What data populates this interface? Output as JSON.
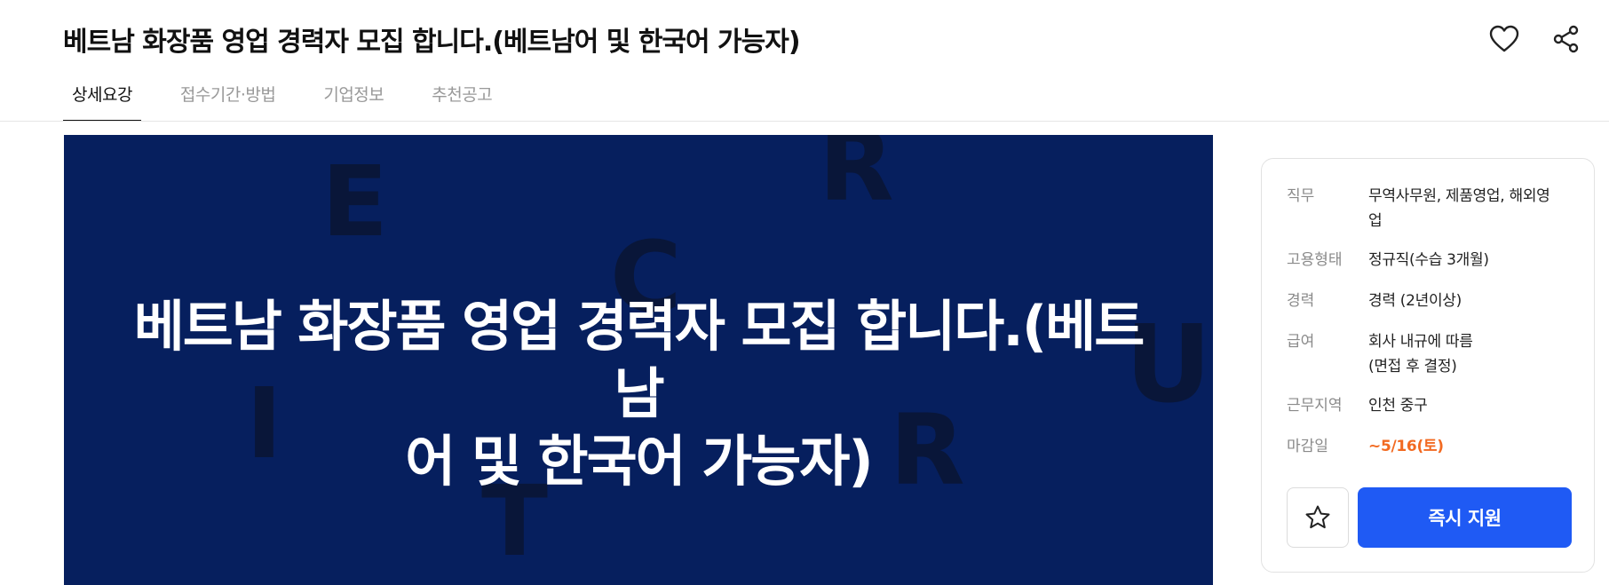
{
  "header": {
    "title": "베트남 화장품 영업 경력자 모집 합니다.(베트남어 및 한국어 가능자)"
  },
  "tabs": [
    {
      "label": "상세요강",
      "active": true
    },
    {
      "label": "접수기간·방법",
      "active": false
    },
    {
      "label": "기업정보",
      "active": false
    },
    {
      "label": "추천공고",
      "active": false
    }
  ],
  "banner": {
    "line1": "베트남 화장품 영업 경력자 모집 합니다.(베트남",
    "line2": "어 및 한국어 가능자)",
    "background_color": "#061f5e",
    "background_letters": [
      "E",
      "R",
      "C",
      "U",
      "I",
      "R",
      "T"
    ]
  },
  "info": {
    "job": {
      "label": "직무",
      "value_line1": "무역사무원, 제품영업, 해외영",
      "value_line2": "업"
    },
    "employment_type": {
      "label": "고용형태",
      "value": "정규직(수습 3개월)"
    },
    "career": {
      "label": "경력",
      "value": "경력 (2년이상)"
    },
    "salary": {
      "label": "급여",
      "value_line1": "회사 내규에 따름",
      "value_line2": "(면접 후 결정)"
    },
    "location": {
      "label": "근무지역",
      "value": "인천 중구"
    },
    "deadline": {
      "label": "마감일",
      "value": "~5/16(토)",
      "color": "#f26a21"
    }
  },
  "actions": {
    "apply_label": "즉시 지원",
    "apply_color": "#1f5af4",
    "bookmark_icon": "star-icon",
    "like_icon": "heart-icon",
    "share_icon": "share-icon"
  }
}
